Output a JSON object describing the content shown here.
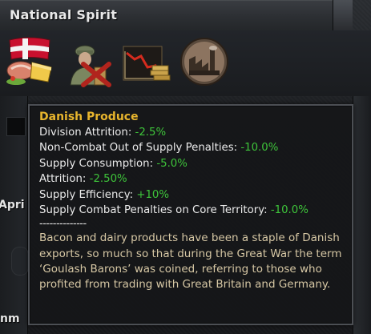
{
  "header": {
    "title": "National Spirit"
  },
  "spirits": [
    {
      "icon": "danish-produce-icon",
      "name": "Danish Produce"
    },
    {
      "icon": "demobilized-soldier-icon",
      "name": "demobilized"
    },
    {
      "icon": "economic-decline-icon",
      "name": "economic"
    },
    {
      "icon": "industry-icon",
      "name": "industry"
    }
  ],
  "background_fragments": {
    "left_label": "Apri",
    "bottom_label": "nm"
  },
  "tooltip": {
    "title": "Danish Produce",
    "modifiers": [
      {
        "label": "Division Attrition: ",
        "value": "-2.5%"
      },
      {
        "label": "Non-Combat Out of Supply Penalties: ",
        "value": "-10.0%"
      },
      {
        "label": "Supply Consumption: ",
        "value": "-5.0%"
      },
      {
        "label": "Attrition: ",
        "value": "-2.50%"
      },
      {
        "label": "Supply Efficiency: ",
        "value": "+10%"
      },
      {
        "label": "Supply Combat Penalties on Core Territory: ",
        "value": "-10.0%"
      }
    ],
    "separator": "--------------",
    "description": "Bacon and dairy products have been a staple of Danish exports, so much so that during the Great War the term ‘Goulash Barons’ was coined, referring to those who profited from trading with Great Britain and Germany."
  },
  "colors": {
    "title_gold": "#e8b52d",
    "modifier_green": "#3ec43a",
    "description_tan": "#d6c7a4"
  }
}
